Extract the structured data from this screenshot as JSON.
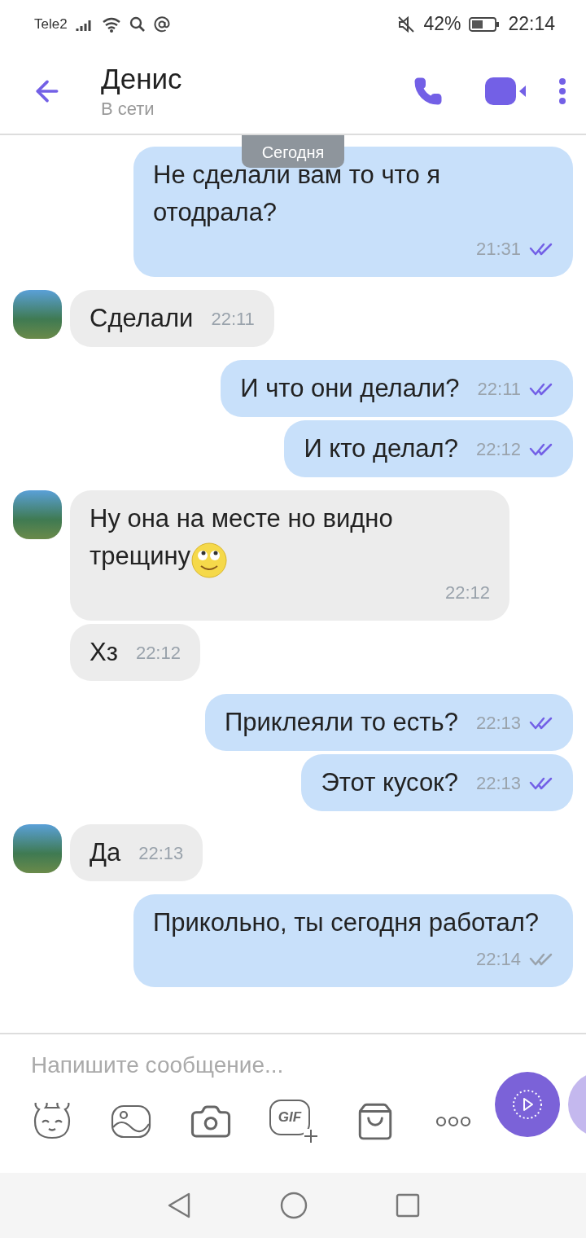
{
  "status_bar": {
    "carrier": "Tele2",
    "battery": "42%",
    "time": "22:14"
  },
  "header": {
    "name": "Денис",
    "status": "В сети"
  },
  "date_chip": "Сегодня",
  "messages": [
    {
      "outgoing": true,
      "text": "Не сделали вам то что я отодрала?",
      "time": "21:31",
      "read": true
    },
    {
      "outgoing": false,
      "text": "Сделали",
      "time": "22:11",
      "show_avatar": true
    },
    {
      "outgoing": true,
      "text": "И что они делали?",
      "time": "22:11",
      "read": true
    },
    {
      "outgoing": true,
      "text": "И кто делал?",
      "time": "22:12",
      "read": true
    },
    {
      "outgoing": false,
      "text": "Ну она на месте но видно трещину",
      "time": "22:12",
      "show_avatar": true,
      "emoticon": true
    },
    {
      "outgoing": false,
      "text": "Хз",
      "time": "22:12",
      "show_avatar": false
    },
    {
      "outgoing": true,
      "text": "Приклеяли то есть?",
      "time": "22:13",
      "read": true
    },
    {
      "outgoing": true,
      "text": "Этот кусок?",
      "time": "22:13",
      "read": true
    },
    {
      "outgoing": false,
      "text": "Да",
      "time": "22:13",
      "show_avatar": true
    },
    {
      "outgoing": true,
      "text": "Прикольно, ты сегодня работал?",
      "time": "22:14",
      "read": false
    }
  ],
  "composer": {
    "placeholder": "Напишите сообщение..."
  },
  "toolbar": [
    {
      "kind": "sticker"
    },
    {
      "kind": "gallery"
    },
    {
      "kind": "camera"
    },
    {
      "kind": "gif",
      "label": "GIF"
    },
    {
      "kind": "shop"
    },
    {
      "kind": "more"
    }
  ]
}
